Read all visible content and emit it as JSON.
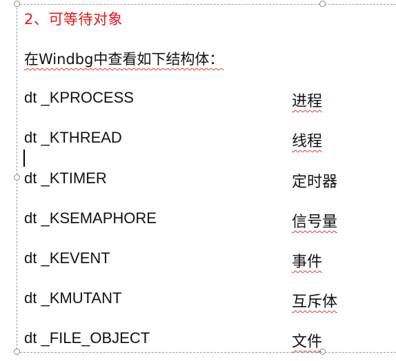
{
  "slide": {
    "heading": "2、可等待对象",
    "intro": "在Windbg中查看如下结构体：",
    "rows": [
      {
        "command": "dt _KPROCESS",
        "description": "进程"
      },
      {
        "command": "dt _KTHREAD",
        "description": "线程"
      },
      {
        "command": "dt _KTIMER",
        "description": "定时器"
      },
      {
        "command": "dt _KSEMAPHORE",
        "description": "信号量"
      },
      {
        "command": "dt _KEVENT",
        "description": "事件"
      },
      {
        "command": "dt _KMUTANT",
        "description": "互斥体"
      },
      {
        "command": "dt _FILE_OBJECT",
        "description": "文件"
      }
    ]
  },
  "colors": {
    "heading": "#e8141a",
    "text": "#111111",
    "spellcheck_underline": "#e0362b",
    "selection_frame": "#9a9a9a"
  }
}
